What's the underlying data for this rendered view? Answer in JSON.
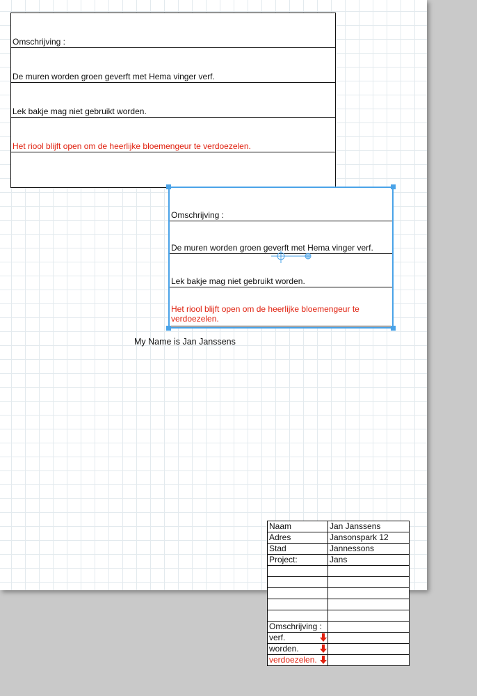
{
  "box1": {
    "rows": [
      {
        "text": "Omschrijving :",
        "color": "#111111"
      },
      {
        "text": "De muren worden groen geverft met Hema vinger verf.",
        "color": "#111111"
      },
      {
        "text": "Lek bakje mag niet gebruikt worden.",
        "color": "#111111"
      },
      {
        "text": "Het riool blijft open om de heerlijke bloemengeur te verdoezelen.",
        "color": "#e0200e"
      },
      {
        "text": "",
        "color": "#111111"
      }
    ]
  },
  "box2": {
    "rows": [
      {
        "text": "Omschrijving :"
      },
      {
        "text": "De muren worden groen geverft met Hema vinger verf."
      },
      {
        "text": "Lek bakje mag niet gebruikt worden."
      },
      {
        "text": "Het riool blijft open om de heerlijke bloemengeur te verdoezelen."
      }
    ],
    "selection_color": "#4aa3e8"
  },
  "name_text": "My Name is Jan Janssens",
  "info_table": {
    "rows": [
      {
        "label": "Naam",
        "value": "Jan Janssens"
      },
      {
        "label": "Adres",
        "value": "Jansonspark 12"
      },
      {
        "label": "Stad",
        "value": "Jannessons"
      },
      {
        "label": "Project:",
        "value": "Jans"
      },
      {
        "label": "",
        "value": ""
      },
      {
        "label": "",
        "value": ""
      },
      {
        "label": "",
        "value": ""
      },
      {
        "label": "",
        "value": ""
      },
      {
        "label": "",
        "value": ""
      },
      {
        "label": "Omschrijving :",
        "value": ""
      },
      {
        "label": "verf.",
        "value": "",
        "overflow": true
      },
      {
        "label": "worden.",
        "value": "",
        "overflow": true
      },
      {
        "label": "verdoezelen.",
        "value": "",
        "overflow": true,
        "red": true
      }
    ],
    "overflow_icon": "red-down-arrow-icon"
  }
}
